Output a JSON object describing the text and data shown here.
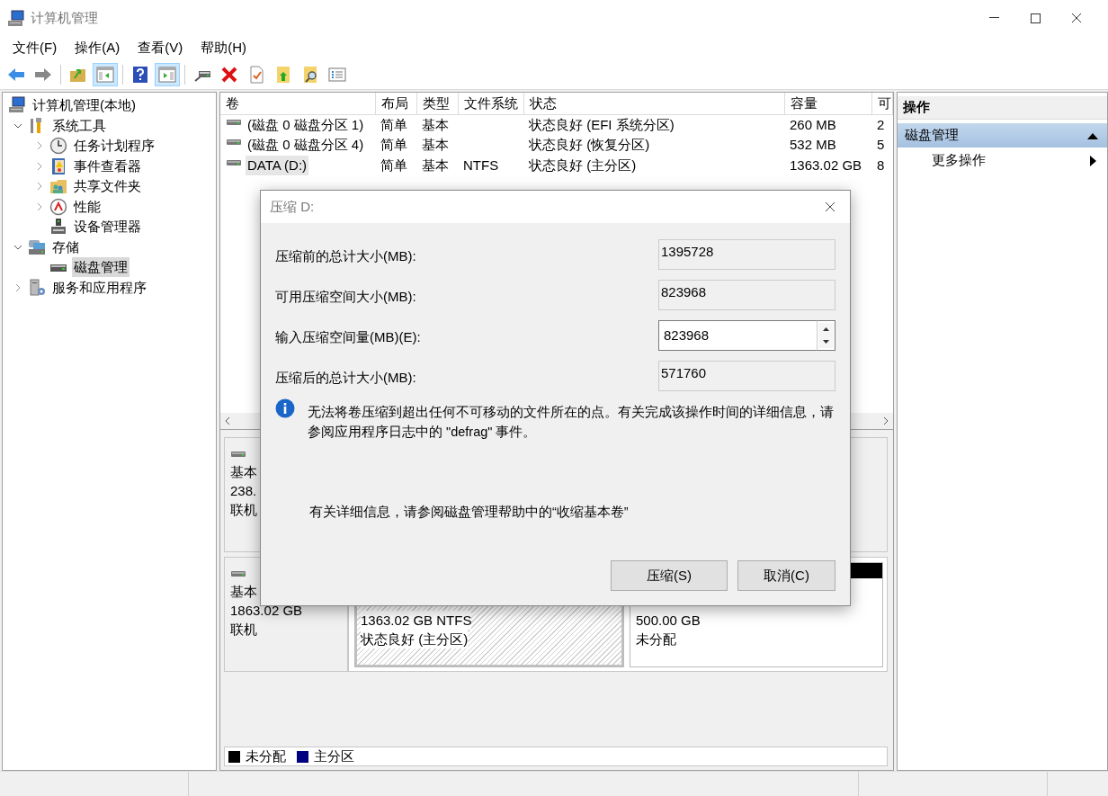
{
  "window": {
    "title": "计算机管理"
  },
  "menu": [
    "文件(F)",
    "操作(A)",
    "查看(V)",
    "帮助(H)"
  ],
  "toolbar_groups": [
    {
      "buttons": [
        {
          "kind": "back",
          "pressed": false
        },
        {
          "kind": "forward",
          "pressed": false
        }
      ]
    },
    {
      "buttons": [
        {
          "kind": "up",
          "pressed": false
        },
        {
          "kind": "tree",
          "pressed": true
        }
      ]
    },
    {
      "buttons": [
        {
          "kind": "help",
          "pressed": false
        },
        {
          "kind": "pane",
          "pressed": true
        }
      ]
    },
    {
      "buttons": [
        {
          "kind": "connect",
          "pressed": false
        },
        {
          "kind": "delete",
          "pressed": false
        },
        {
          "kind": "properties",
          "pressed": false
        },
        {
          "kind": "export",
          "pressed": false
        },
        {
          "kind": "find",
          "pressed": false
        },
        {
          "kind": "list",
          "pressed": false
        }
      ]
    }
  ],
  "tree": [
    {
      "label": "计算机管理(本地)",
      "kind": "computer",
      "selected": false,
      "children": [
        {
          "label": "系统工具",
          "kind": "tools",
          "expanded": true,
          "selected": false,
          "children": [
            {
              "label": "任务计划程序",
              "kind": "clock",
              "expanded": false,
              "selected": false
            },
            {
              "label": "事件查看器",
              "kind": "event",
              "expanded": false,
              "selected": false
            },
            {
              "label": "共享文件夹",
              "kind": "share",
              "expanded": false,
              "selected": false
            },
            {
              "label": "性能",
              "kind": "perf",
              "expanded": false,
              "selected": false
            },
            {
              "label": "设备管理器",
              "kind": "device",
              "selected": false
            }
          ]
        },
        {
          "label": "存储",
          "kind": "storage",
          "expanded": true,
          "selected": false,
          "children": [
            {
              "label": "磁盘管理",
              "kind": "disk",
              "selected": true
            }
          ]
        },
        {
          "label": "服务和应用程序",
          "kind": "services",
          "expanded": false,
          "selected": false
        }
      ]
    }
  ],
  "table": {
    "columns": [
      "卷",
      "布局",
      "类型",
      "文件系统",
      "状态",
      "容量",
      "可"
    ],
    "rows": [
      {
        "cells": [
          "(磁盘 0 磁盘分区 1)",
          "简单",
          "基本",
          "",
          "状态良好 (EFI 系统分区)",
          "260 MB",
          "2"
        ],
        "selected": false
      },
      {
        "cells": [
          "(磁盘 0 磁盘分区 4)",
          "简单",
          "基本",
          "",
          "状态良好 (恢复分区)",
          "532 MB",
          "5"
        ],
        "selected": false
      },
      {
        "cells": [
          "DATA (D:)",
          "简单",
          "基本",
          "NTFS",
          "状态良好 (主分区)",
          "1363.02 GB",
          "8"
        ],
        "selected": true
      }
    ]
  },
  "disks": [
    {
      "lines": [
        "基本",
        "238.",
        "联机"
      ]
    },
    {
      "lines": [
        "基本",
        "1863.02 GB",
        "联机"
      ],
      "partitions": [
        {
          "kind": "primary",
          "lines": [
            "1363.02 GB NTFS",
            "状态良好 (主分区)"
          ]
        },
        {
          "kind": "unallocated",
          "lines": [
            "500.00 GB",
            "未分配"
          ]
        }
      ]
    }
  ],
  "legend": [
    {
      "label": "未分配",
      "color": "#000000"
    },
    {
      "label": "主分区",
      "color": "#000080"
    }
  ],
  "actions": {
    "title": "操作",
    "section": {
      "label": "磁盘管理",
      "expanded": true
    },
    "items": [
      "更多操作"
    ]
  },
  "dialog": {
    "title": "压缩 D:",
    "fields": [
      {
        "label": "压缩前的总计大小(MB):",
        "value": "1395728",
        "kind": "readonly"
      },
      {
        "label": "可用压缩空间大小(MB):",
        "value": "823968",
        "kind": "readonly"
      },
      {
        "label": "输入压缩空间量(MB)(E):",
        "value": "823968",
        "kind": "spin"
      },
      {
        "label": "压缩后的总计大小(MB):",
        "value": "571760",
        "kind": "readonly"
      }
    ],
    "info": "无法将卷压缩到超出任何不可移动的文件所在的点。有关完成该操作时间的详细信息，请参阅应用程序日志中的 \"defrag\" 事件。",
    "help": "有关详细信息，请参阅磁盘管理帮助中的“收缩基本卷”",
    "buttons": [
      "压缩(S)",
      "取消(C)"
    ]
  }
}
